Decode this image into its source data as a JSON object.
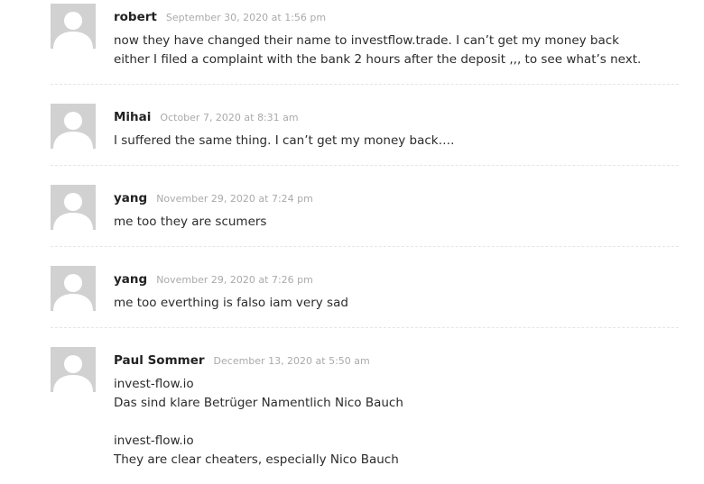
{
  "comments": [
    {
      "author": "robert",
      "date": "September 30, 2020 at 1:56 pm",
      "paragraphs": [
        [
          "now they have changed their name to investflow.trade. I can’t get my money back",
          "either I filed a complaint with the bank 2 hours after the deposit ,,, to see what’s next."
        ]
      ]
    },
    {
      "author": "Mihai",
      "date": "October 7, 2020 at 8:31 am",
      "paragraphs": [
        [
          "I suffered the same thing. I can’t get my money back…."
        ]
      ]
    },
    {
      "author": "yang",
      "date": "November 29, 2020 at 7:24 pm",
      "paragraphs": [
        [
          "me too they are scumers"
        ]
      ]
    },
    {
      "author": "yang",
      "date": "November 29, 2020 at 7:26 pm",
      "paragraphs": [
        [
          "me too everthing is falso iam very sad"
        ]
      ]
    },
    {
      "author": "Paul Sommer",
      "date": "December 13, 2020 at 5:50 am",
      "paragraphs": [
        [
          "invest-flow.io",
          "Das sind klare Betrüger Namentlich Nico Bauch"
        ],
        [
          "invest-flow.io",
          "They are clear cheaters, especially Nico Bauch"
        ]
      ]
    }
  ],
  "icons": {
    "avatar": "default-avatar-icon"
  },
  "colors": {
    "avatar_bg": "#d1d1d1",
    "avatar_fg": "#ffffff",
    "author": "#222222",
    "date": "#aaaaaa",
    "text": "#2b2b2b",
    "divider": "#e6e6e6"
  }
}
